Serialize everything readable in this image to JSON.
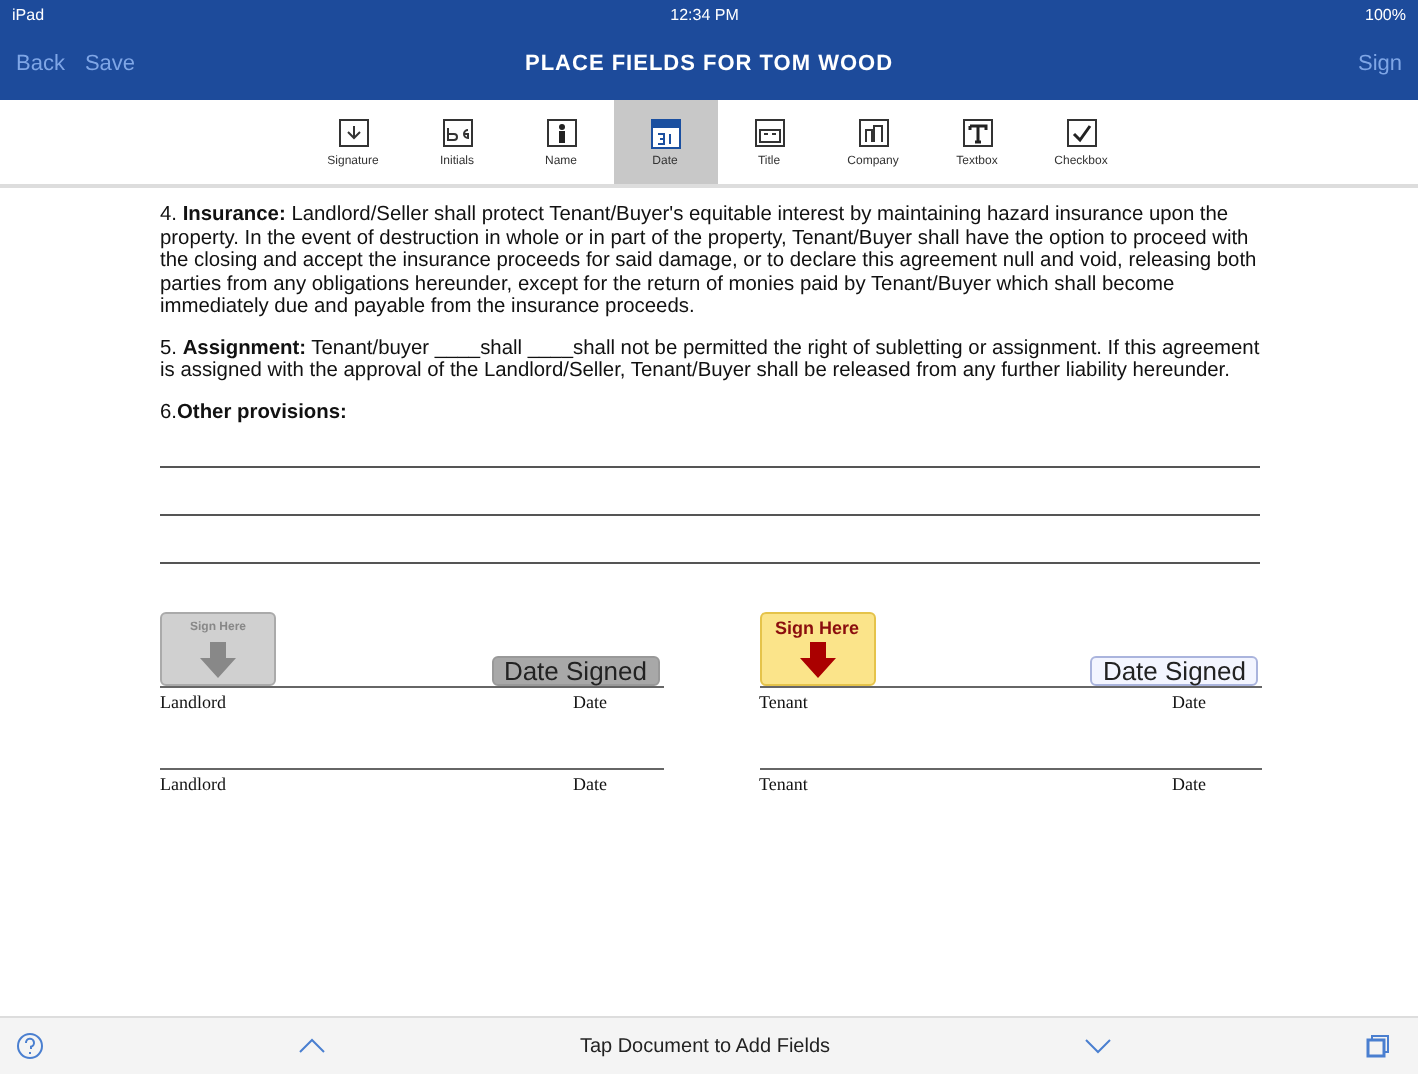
{
  "status_bar": {
    "carrier": "iPad",
    "time": "12:34 PM",
    "battery": "100%"
  },
  "nav": {
    "back": "Back",
    "save": "Save",
    "title": "PLACE FIELDS FOR TOM WOOD",
    "sign": "Sign"
  },
  "tools": [
    {
      "kind": "signature",
      "label": "Signature",
      "selected": false
    },
    {
      "kind": "initials",
      "label": "Initials",
      "selected": false
    },
    {
      "kind": "name",
      "label": "Name",
      "selected": false
    },
    {
      "kind": "date",
      "label": "Date",
      "selected": true
    },
    {
      "kind": "title",
      "label": "Title",
      "selected": false
    },
    {
      "kind": "company",
      "label": "Company",
      "selected": false
    },
    {
      "kind": "textbox",
      "label": "Textbox",
      "selected": false
    },
    {
      "kind": "checkbox",
      "label": "Checkbox",
      "selected": false
    }
  ],
  "document": {
    "paragraphs": [
      "4. **Insurance:** Landlord/Seller shall protect Tenant/Buyer's equitable interest by maintaining hazard insurance upon the property. In the event of destruction in whole or in part of the property, Tenant/Buyer shall have the option to proceed with the closing and accept the insurance proceeds for said damage, or to declare this agreement null and void, releasing both parties from any obligations hereunder, except for the return of monies paid by Tenant/Buyer which shall become immediately due and payable from the insurance proceeds.",
      "5. **Assignment:** Tenant/buyer ____shall ____shall not be permitted the right of subletting or assignment. If this agreement is assigned with the approval of the Landlord/Seller, Tenant/Buyer shall be released from any further liability hereunder.",
      "6.**Other provisions:**"
    ],
    "signature_columns": [
      {
        "sign_field": {
          "label": "Sign Here",
          "selected": false
        },
        "date_field": {
          "label": "Date Signed",
          "selected": false
        },
        "lines": [
          {
            "party": "Landlord",
            "date": "Date"
          },
          {
            "party": "Landlord",
            "date": "Date"
          }
        ]
      },
      {
        "sign_field": {
          "label": "Sign Here",
          "selected": true
        },
        "date_field": {
          "label": "Date Signed",
          "selected": true
        },
        "lines": [
          {
            "party": "Tenant",
            "date": "Date"
          },
          {
            "party": "Tenant",
            "date": "Date"
          }
        ]
      }
    ]
  },
  "bottom_bar": {
    "hint": "Tap Document to Add Fields"
  }
}
